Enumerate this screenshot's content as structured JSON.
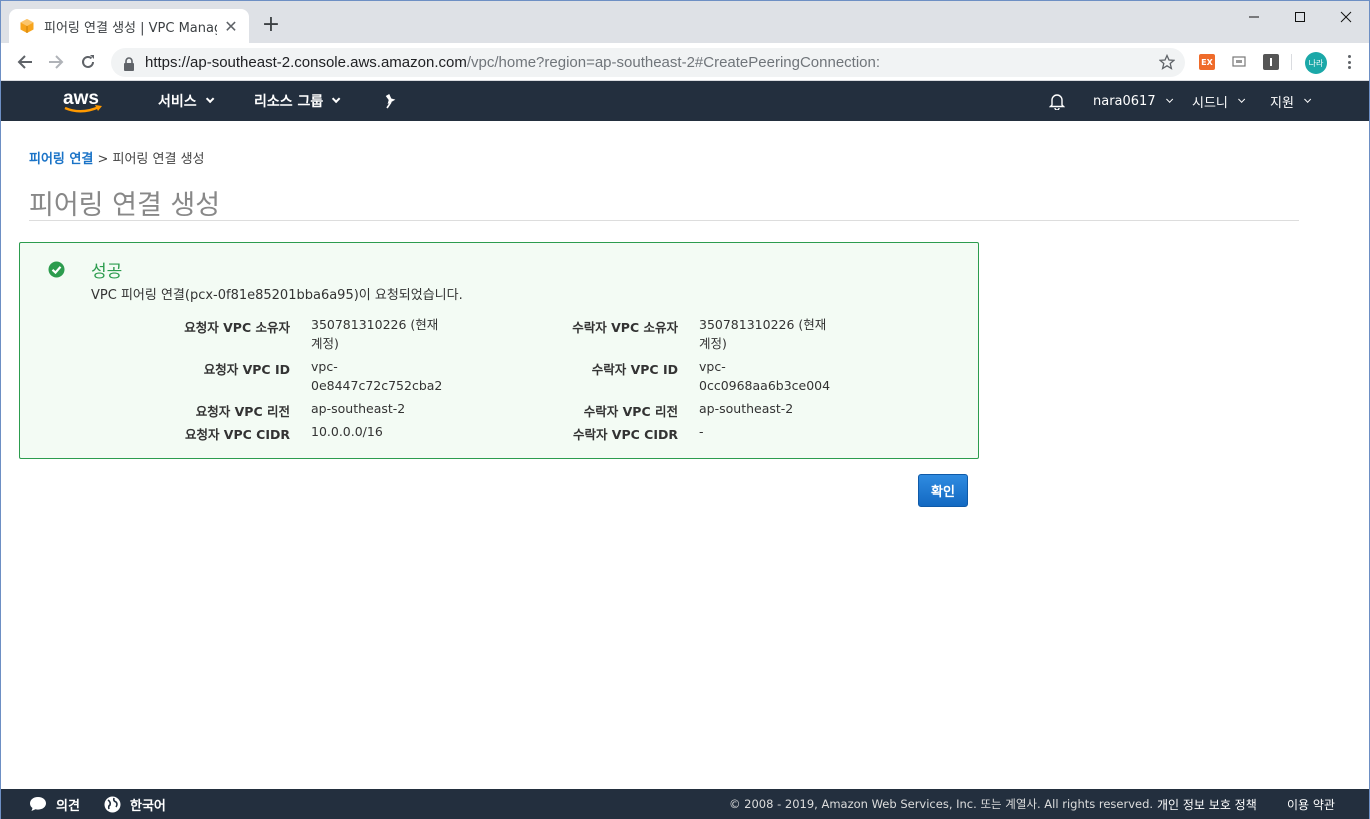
{
  "browser": {
    "tab_title": "피어링 연결 생성 | VPC Manage",
    "url_host": "https://ap-southeast-2.console.aws.amazon.com",
    "url_path": "/vpc/home?region=ap-southeast-2#CreatePeeringConnection:",
    "profile_label": "나라",
    "ext_label": "EX"
  },
  "aws_header": {
    "logo_text": "aws",
    "services": "서비스",
    "resource_groups": "리소스 그룹",
    "user": "nara0617",
    "region": "시드니",
    "support": "지원"
  },
  "breadcrumb": {
    "parent": "피어링 연결",
    "separator": ">",
    "current": "피어링 연결 생성"
  },
  "page_title": "피어링 연결 생성",
  "success": {
    "heading": "성공",
    "message": "VPC 피어링 연결(pcx-0f81e85201bba6a95)이 요청되었습니다.",
    "requester": [
      {
        "label": "요청자 VPC 소유자",
        "value_line1": "350781310226 (현재",
        "value_line2": "계정)"
      },
      {
        "label": "요청자 VPC ID",
        "value_line1": "vpc-",
        "value_line2": "0e8447c72c752cba2"
      },
      {
        "label": "요청자 VPC 리전",
        "value_line1": "ap-southeast-2",
        "value_line2": ""
      },
      {
        "label": "요청자 VPC CIDR",
        "value_line1": "10.0.0.0/16",
        "value_line2": ""
      }
    ],
    "accepter": [
      {
        "label": "수락자 VPC 소유자",
        "value_line1": "350781310226 (현재",
        "value_line2": "계정)"
      },
      {
        "label": "수락자 VPC ID",
        "value_line1": "vpc-",
        "value_line2": "0cc0968aa6b3ce004"
      },
      {
        "label": "수락자 VPC 리전",
        "value_line1": "ap-southeast-2",
        "value_line2": ""
      },
      {
        "label": "수락자 VPC CIDR",
        "value_line1": "-",
        "value_line2": ""
      }
    ]
  },
  "ok_button": "확인",
  "footer": {
    "feedback": "의견",
    "language": "한국어",
    "copyright": "© 2008 - 2019, Amazon Web Services, Inc. 또는 계열사. All rights reserved.",
    "privacy": "개인 정보 보호 정책",
    "terms": "이용 약관"
  },
  "colors": {
    "aws_nav": "#232f3e",
    "success_green": "#2c9c4e",
    "link_blue": "#1a73c7",
    "button_blue": "#1369c2"
  }
}
